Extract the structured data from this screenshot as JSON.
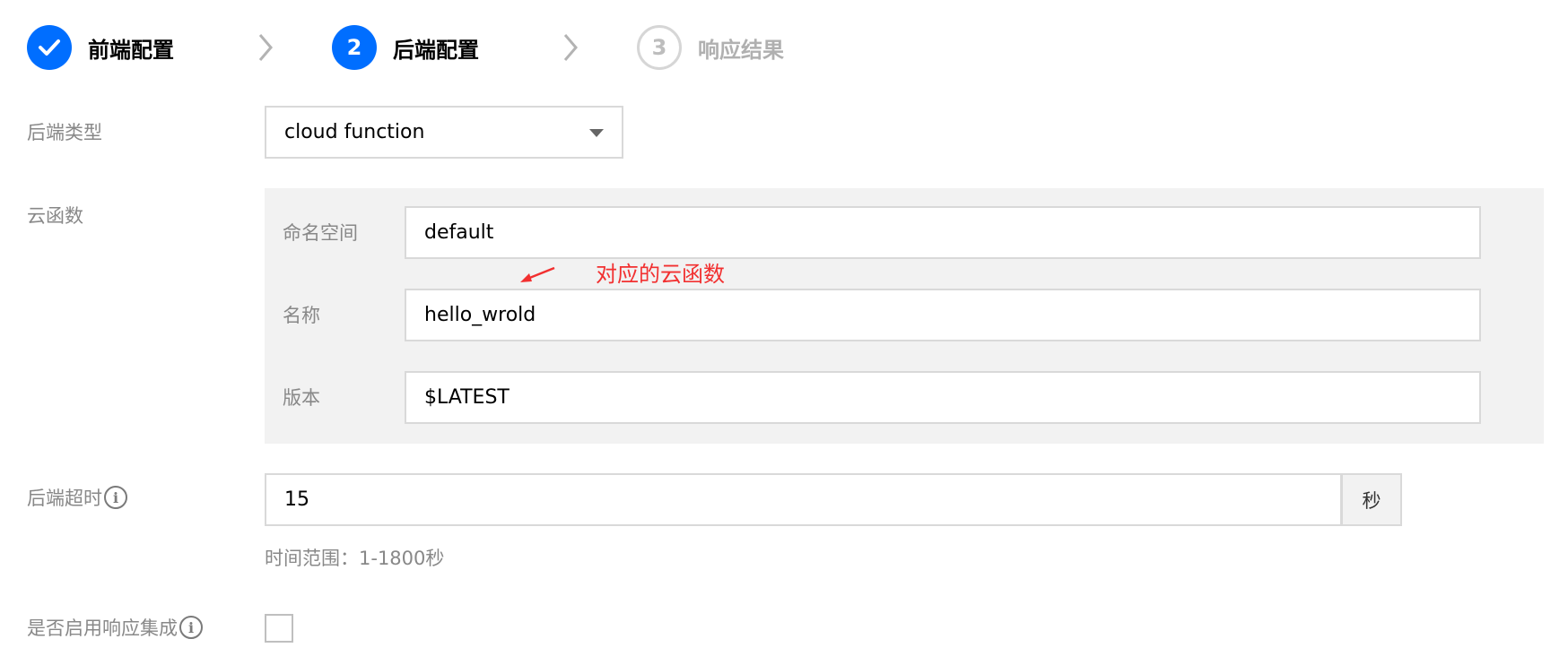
{
  "steps": [
    {
      "number": "",
      "label": "前端配置",
      "state": "done"
    },
    {
      "number": "2",
      "label": "后端配置",
      "state": "active"
    },
    {
      "number": "3",
      "label": "响应结果",
      "state": "pending"
    }
  ],
  "backend_type": {
    "label": "后端类型",
    "value": "cloud function"
  },
  "cloud_function": {
    "label": "云函数",
    "namespace": {
      "label": "命名空间",
      "value": "default"
    },
    "name": {
      "label": "名称",
      "value": "hello_wrold"
    },
    "version": {
      "label": "版本",
      "value": "$LATEST"
    }
  },
  "annotation": "对应的云函数",
  "timeout": {
    "label": "后端超时",
    "value": "15",
    "unit": "秒",
    "hint": "时间范围：1-1800秒"
  },
  "response_integration": {
    "label": "是否启用响应集成",
    "checked": false
  },
  "colors": {
    "accent": "#006eff",
    "annotation": "#f23030"
  },
  "icons": {
    "done": "check-icon",
    "separator": "chevron-right-icon",
    "info": "info-circle-icon"
  }
}
